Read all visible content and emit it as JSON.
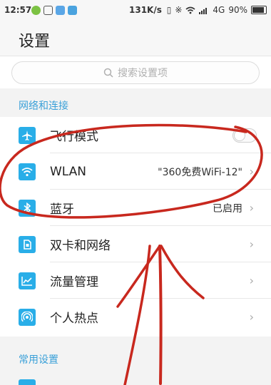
{
  "status_bar": {
    "time": "12:57",
    "network_speed": "131K/s",
    "signal_type": "4G",
    "battery_percent": "90%",
    "battery_level": 0.9
  },
  "header": {
    "title": "设置"
  },
  "search": {
    "placeholder": "搜索设置项"
  },
  "sections": {
    "network": {
      "title": "网络和连接"
    },
    "common": {
      "title": "常用设置"
    }
  },
  "rows": {
    "airplane": {
      "label": "飞行模式",
      "icon": "airplane-icon",
      "toggle_on": false
    },
    "wlan": {
      "label": "WLAN",
      "value": "\"360免费WiFi-12\"",
      "icon": "wifi-icon"
    },
    "bluetooth": {
      "label": "蓝牙",
      "value": "已启用",
      "icon": "bluetooth-icon"
    },
    "dual_sim": {
      "label": "双卡和网络",
      "icon": "sim-card-icon"
    },
    "data_usage": {
      "label": "流量管理",
      "icon": "chart-icon"
    },
    "hotspot": {
      "label": "个人热点",
      "icon": "hotspot-icon"
    }
  },
  "colors": {
    "accent": "#29aee8",
    "section_label": "#3aa0d8",
    "annotation": "#c8281e"
  }
}
